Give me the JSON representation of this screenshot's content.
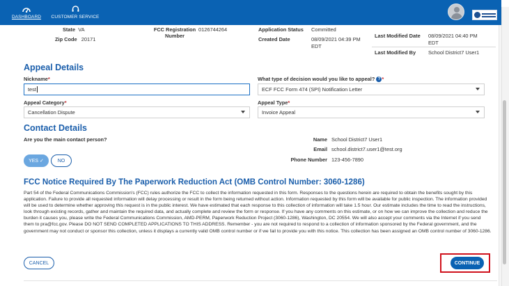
{
  "nav": {
    "dashboard_label": "DASHBOARD",
    "customer_service_label": "CUSTOMER SERVICE"
  },
  "summary": {
    "state_label": "State",
    "state_value": "VA",
    "zip_label": "Zip Code",
    "zip_value": "20171",
    "fcc_reg_label_1": "FCC Registration",
    "fcc_reg_label_2": "Number",
    "fcc_reg_value": "0126744264",
    "app_status_label": "Application Status",
    "app_status_value": "Committed",
    "created_label": "Created Date",
    "created_value_1": "08/09/2021 04:39 PM",
    "created_value_2": "EDT",
    "last_mod_date_label": "Last Modified Date",
    "last_mod_date_value_1": "08/09/2021 04:40 PM",
    "last_mod_date_value_2": "EDT",
    "last_mod_by_label": "Last Modified By",
    "last_mod_by_value": "School District7 User1"
  },
  "appeal": {
    "section_title": "Appeal Details",
    "nickname_label": "Nickname",
    "nickname_value": "test",
    "decision_label": "What type of decision would you like to appeal?",
    "decision_value": "ECF FCC Form 474 (SPI) Notification Letter",
    "category_label": "Appeal Category",
    "category_value": "Cancellation Dispute",
    "type_label": "Appeal Type",
    "type_value": "Invoice Appeal",
    "required_mark": "*",
    "help_glyph": "?"
  },
  "contact": {
    "section_title": "Contact Details",
    "main_contact_question": "Are you the main contact person?",
    "yes_label": "YES ✓",
    "no_label": "NO",
    "name_label": "Name",
    "name_value": "School District7 User1",
    "email_label": "Email",
    "email_value": "school.district7.user1@test.org",
    "phone_label": "Phone Number",
    "phone_value": "123-456-7890"
  },
  "notice": {
    "title": "FCC Notice Required By The Paperwork Reduction Act (OMB Control Number: 3060-1286)",
    "body": "Part 54 of the Federal Communications Commission's (FCC) rules authorize the FCC to collect the information requested in this form. Responses to the questions herein are required to obtain the benefits sought by this application. Failure to provide all requested information will delay processing or result in the form being returned without action. Information requested by this form will be available for public inspection. The information provided will be used to determine whether approving this request is in the public interest. We have estimated that each response to this collection of information will take 1.5 hour. Our estimate includes the time to read the instructions, look through existing records, gather and maintain the required data, and actually complete and review the form or response. If you have any comments on this estimate, or on how we can improve the collection and reduce the burden it causes you, please write the Federal Communications Commission, AMD-PERM, Paperwork Reduction Project (3060-1286), Washington, DC 20554. We will also accept your comments via the Internet if you send them to pra@fcc.gov. Please DO NOT SEND COMPLETED APPLICATIONS TO THIS ADDRESS. Remember - you are not required to respond to a collection of information sponsored by the Federal government, and the government may not conduct or sponsor this collection, unless it displays a currently valid OMB control number or if we fail to provide you with this notice. This collection has been assigned an OMB control number of 3060-1286."
  },
  "actions": {
    "cancel_label": "CANCEL",
    "continue_label": "CONTINUE"
  },
  "icons": {
    "dashboard": "gauge-icon",
    "customer_service": "headset-icon",
    "avatar": "user-avatar-icon",
    "logo": "agency-logo-icon",
    "dropdown": "chevron-down-icon",
    "help": "help-circle-icon"
  },
  "colors": {
    "nav": "#0a62b3",
    "section_title": "#1a5eab",
    "highlight": "#d0111c"
  }
}
